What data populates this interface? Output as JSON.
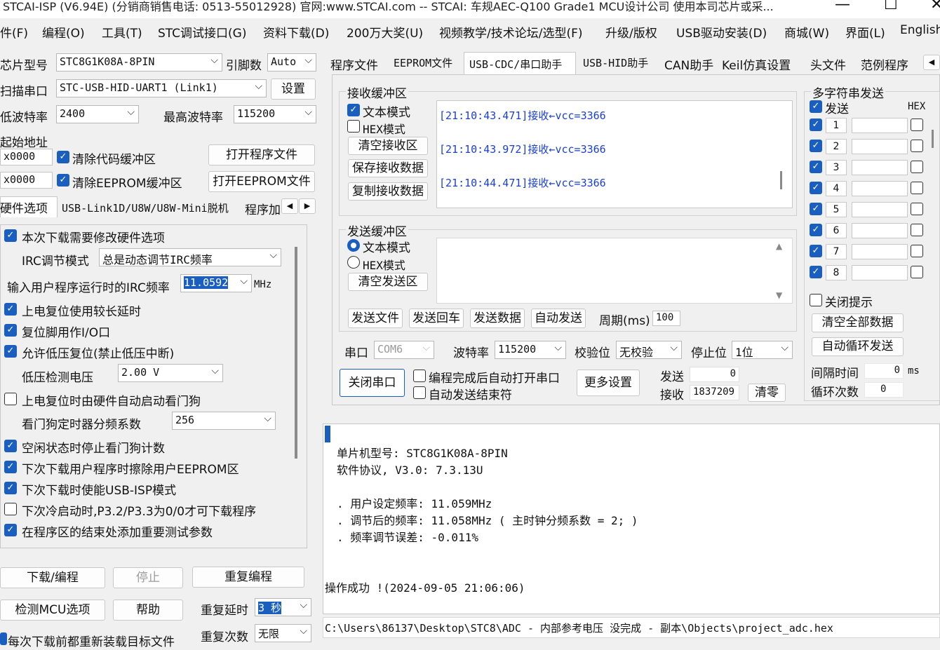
{
  "title": "STCAI-ISP (V6.94E) (分销商销售电话: 0513-55012928) 官网:www.STCAI.com  -- STCAI: 车规AEC-Q100 Grade1 MCU设计公司 使用本司芯片或采...",
  "window_controls": {
    "minimize": "—",
    "maximize": "☐",
    "close": "✕"
  },
  "menu": [
    "件(F)",
    "编程(O)",
    "工具(T)",
    "STC调试接口(G)",
    "资料下载(D)",
    "200万大奖(U)",
    "视频教学/技术论坛/选型(F)",
    "升级/版权",
    "USB驱动安装(D)",
    "商城(W)",
    "界面(L)",
    "English"
  ],
  "left": {
    "chip_label": "芯片型号",
    "chip_value": "STC8G1K08A-8PIN",
    "pins_label": "引脚数",
    "pins_value": "Auto",
    "port_label": "扫描串口",
    "port_value": "STC-USB-HID-UART1 (Link1)",
    "port_button": "设置",
    "min_baud_label": "低波特率",
    "min_baud_value": "2400",
    "max_baud_label": "最高波特率",
    "max_baud_value": "115200",
    "start_addr_label": "起始地址",
    "addr1": "x0000",
    "clear_code_label": "清除代码缓冲区",
    "open_prog_button": "打开程序文件",
    "addr2": "x0000",
    "clear_eeprom_label": "清除EEPROM缓冲区",
    "open_eeprom_button": "打开EEPROM文件",
    "tabs": [
      "硬件选项",
      "USB-Link1D/U8W/U8W-Mini脱机",
      "程序加"
    ],
    "options": {
      "opt1": "本次下载需要修改硬件选项",
      "irc_mode_label": "IRC调节模式",
      "irc_mode_value": "总是动态调节IRC频率",
      "irc_freq_label": "输入用户程序运行时的IRC频率",
      "irc_freq_value": "11.0592",
      "irc_freq_unit": "MHz",
      "opt2": "上电复位使用较长延时",
      "opt3": "复位脚用作I/O口",
      "opt4": "允许低压复位(禁止低压中断)",
      "lv_label": "低压检测电压",
      "lv_value": "2.00 V",
      "opt5": "上电复位时由硬件自动启动看门狗",
      "wdt_label": "看门狗定时器分频系数",
      "wdt_value": "256",
      "opt6": "空闲状态时停止看门狗计数",
      "opt7": "下次下载用户程序时擦除用户EEPROM区",
      "opt8": "下次下载时使能USB-ISP模式",
      "opt9": "下次冷启动时,P3.2/P3.3为0/0才可下载程序",
      "opt10": "在程序区的结束处添加重要测试参数"
    },
    "download_button": "下载/编程",
    "stop_button": "停止",
    "repeat_button": "重复编程",
    "check_button": "检测MCU选项",
    "help_button": "帮助",
    "repeat_delay_label": "重复延时",
    "repeat_delay_value": "3 秒",
    "reload_label": "每次下载前都重新装载目标文件",
    "repeat_count_label": "重复次数",
    "repeat_count_value": "无限"
  },
  "right_tabs": [
    "程序文件",
    "EEPROM文件",
    "USB-CDC/串口助手",
    "USB-HID助手",
    "CAN助手",
    "Keil仿真设置",
    "头文件",
    "范例程序"
  ],
  "recv": {
    "group_title": "接收缓冲区",
    "text_mode": "文本模式",
    "hex_mode": "HEX模式",
    "clear": "清空接收区",
    "save": "保存接收数据",
    "copy": "复制接收数据",
    "lines": [
      "[21:10:43.471]接收←vcc=3366",
      "[21:10:43.972]接收←vcc=3366",
      "[21:10:44.471]接收←vcc=3366"
    ]
  },
  "send": {
    "group_title": "发送缓冲区",
    "text_mode": "文本模式",
    "hex_mode": "HEX模式",
    "clear": "清空发送区",
    "send_file": "发送文件",
    "send_return": "发送回车",
    "send_data": "发送数据",
    "auto_send": "自动发送",
    "period_label": "周期(ms)",
    "period_value": "100"
  },
  "serial": {
    "port_label": "串口",
    "port_value": "COM6",
    "baud_label": "波特率",
    "baud_value": "115200",
    "parity_label": "校验位",
    "parity_value": "无校验",
    "stop_label": "停止位",
    "stop_value": "1位",
    "close_button": "关闭串口",
    "auto_open_label": "编程完成后自动打开串口",
    "auto_end_label": "自动发送结束符",
    "more_button": "更多设置",
    "send_label": "发送",
    "send_count": "0",
    "recv_label": "接收",
    "recv_count": "1837209",
    "clear_button": "清零"
  },
  "multi": {
    "title": "多字符串发送",
    "send_label": "发送",
    "hex_label": "HEX",
    "rows": [
      "1",
      "2",
      "3",
      "4",
      "5",
      "6",
      "7",
      "8"
    ],
    "close_hint": "关闭提示",
    "clear_all": "清空全部数据",
    "auto_loop": "自动循环发送",
    "interval_label": "间隔时间",
    "interval_value": "0",
    "interval_unit": "ms",
    "loop_label": "循环次数",
    "loop_value": "0"
  },
  "log": {
    "lines": [
      "单片机型号: STC8G1K08A-8PIN",
      "软件协议, V3.0: 7.3.13U",
      ". 用户设定频率: 11.059MHz",
      ". 调节后的频率: 11.058MHz ( 主时钟分频系数 = 2; )",
      ". 频率调节误差: -0.011%",
      "操作成功 !(2024-09-05 21:06:06)"
    ]
  },
  "status_path": "C:\\Users\\86137\\Desktop\\STC8\\ADC - 内部参考电压 没完成 - 副本\\Objects\\project_adc.hex",
  "colors": {
    "accent": "#1a5fbf",
    "recv_text": "#1a3fd0"
  }
}
